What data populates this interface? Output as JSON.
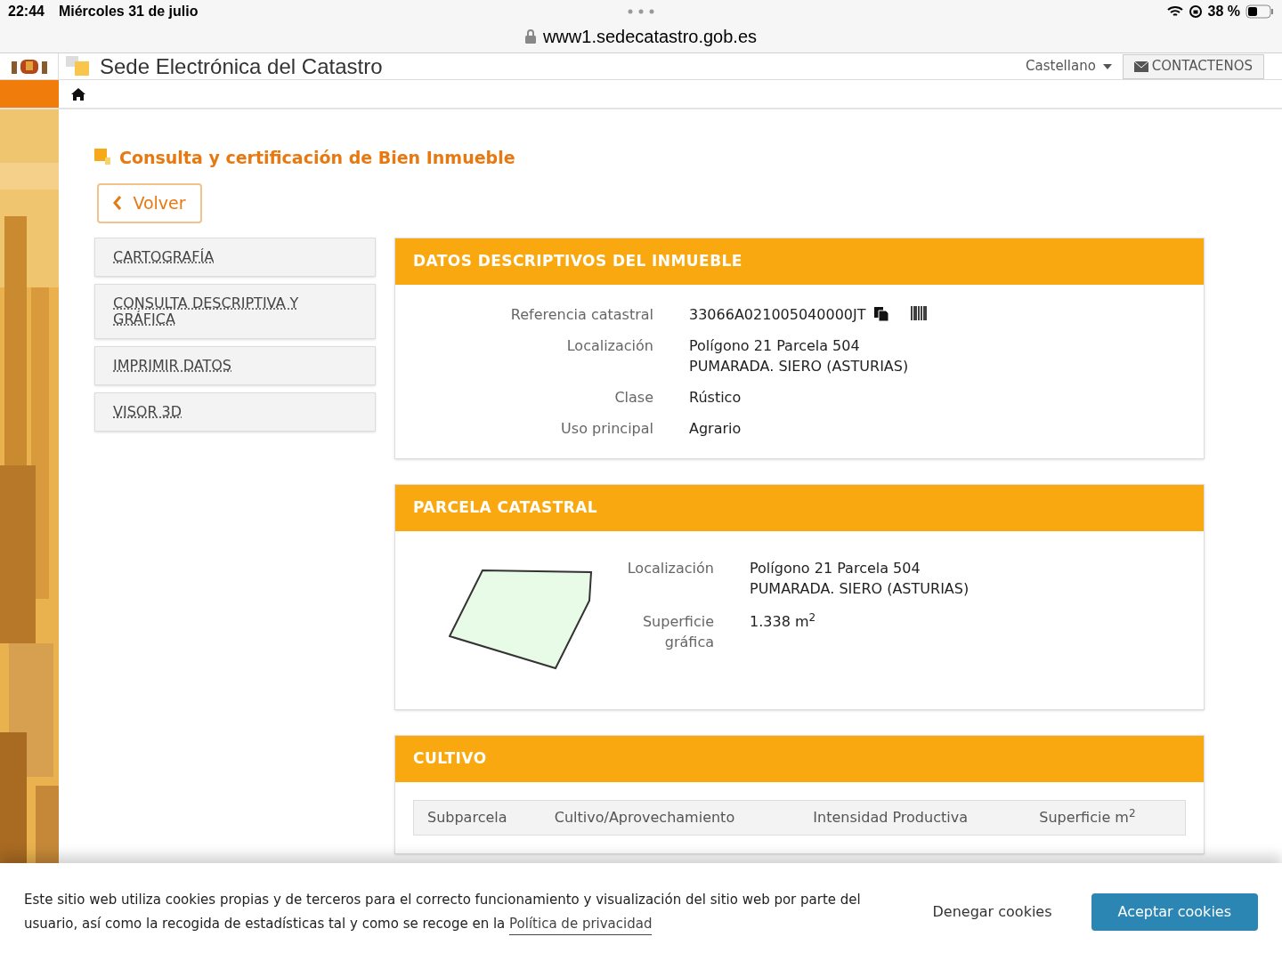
{
  "status_bar": {
    "time": "22:44",
    "date": "Miércoles 31 de julio",
    "battery": "38 %"
  },
  "browser": {
    "url": "www1.sedecatastro.gob.es"
  },
  "header": {
    "title": "Sede Electrónica del Catastro",
    "language": "Castellano",
    "contact": "CONTACTENOS"
  },
  "page_title": "Consulta y certificación de Bien Inmueble",
  "back_button": "Volver",
  "side_menu": [
    {
      "label": "CARTOGRAFÍA"
    },
    {
      "label": "CONSULTA DESCRIPTIVA Y GRÁFICA"
    },
    {
      "label": "IMPRIMIR DATOS"
    },
    {
      "label": "VISOR 3D"
    }
  ],
  "datos": {
    "title": "DATOS DESCRIPTIVOS DEL INMUEBLE",
    "rows": [
      {
        "label": "Referencia catastral",
        "lines": [
          "33066A021005040000JT"
        ],
        "kind": "reference"
      },
      {
        "label": "Localización",
        "lines": [
          "Polígono 21 Parcela 504",
          "PUMARADA. SIERO (ASTURIAS)"
        ],
        "kind": "text"
      },
      {
        "label": "Clase",
        "lines": [
          "Rústico"
        ],
        "kind": "text"
      },
      {
        "label": "Uso principal",
        "lines": [
          "Agrario"
        ],
        "kind": "text"
      }
    ]
  },
  "parcela": {
    "title": "PARCELA CATASTRAL",
    "rows": [
      {
        "label": "Localización",
        "lines": [
          "Polígono 21 Parcela 504",
          "PUMARADA. SIERO (ASTURIAS)"
        ]
      },
      {
        "label": "Superficie gráfica",
        "lines": [
          "1.338 m$^{2}$"
        ]
      }
    ]
  },
  "cultivo": {
    "title": "CULTIVO",
    "columns": [
      "Subparcela",
      "Cultivo/Aprovechamiento",
      "Intensidad Productiva",
      "Superficie m$^{2}$"
    ]
  },
  "cookie_banner": {
    "text": "Este sitio web utiliza cookies propias y de terceros para el correcto funcionamiento y visualización del sitio web por parte del usuario, así como la recogida de estadísticas tal y como se recoge en la",
    "link": "Política de privacidad",
    "deny": "Denegar cookies",
    "accept": "Aceptar cookies"
  }
}
